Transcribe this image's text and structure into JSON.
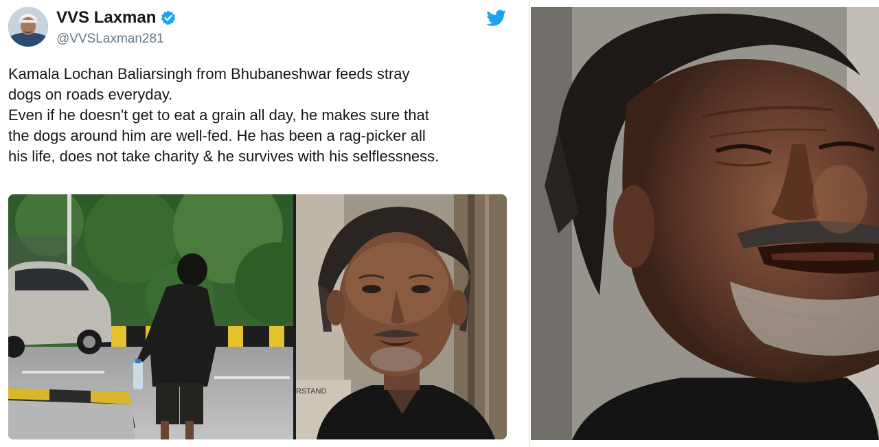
{
  "tweet": {
    "display_name": "VVS Laxman",
    "handle": "@VVSLaxman281",
    "verified": true,
    "text_lines": [
      "Kamala Lochan Baliarsingh from Bhubaneshwar feeds stray",
      "dogs on roads everyday.",
      "Even if he doesn't get to eat a grain all day, he makes sure that",
      "the dogs around him are well-fed. He has been a rag-picker all",
      "his life, does not take charity & he survives with his selflessness."
    ],
    "media": [
      {
        "name": "street-photo",
        "caption": ""
      },
      {
        "name": "portrait-photo",
        "sign_text": "RSTAND"
      }
    ]
  },
  "icons": {
    "brand": "twitter-bird-icon",
    "verified": "verified-badge-icon"
  },
  "colors": {
    "twitter_blue": "#1da1f2",
    "text_primary": "#14171a",
    "text_secondary": "#657786",
    "divider": "#e6ecf0"
  }
}
